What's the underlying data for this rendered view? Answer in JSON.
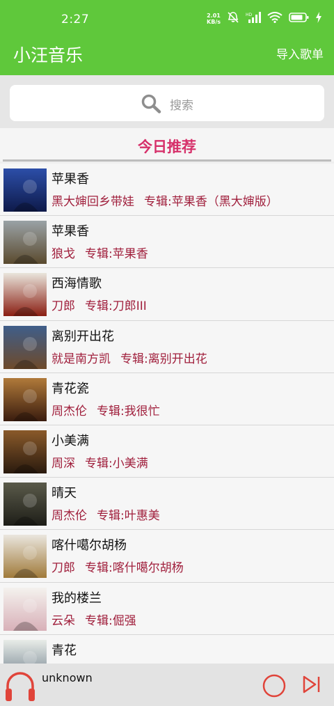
{
  "status_bar": {
    "time": "2:27",
    "net_speed_value": "2.01",
    "net_speed_unit": "KB/s"
  },
  "app_bar": {
    "title": "小汪音乐",
    "action_label": "导入歌单"
  },
  "search": {
    "placeholder": "搜索"
  },
  "section": {
    "title": "今日推荐"
  },
  "songs": [
    {
      "title": "苹果香",
      "artist": "黑大婶回乡带娃",
      "album": "专辑:苹果香（黑大婶版）",
      "cover_colors": [
        "#2c4ea8",
        "#0e1a4a"
      ]
    },
    {
      "title": "苹果香",
      "artist": "狼戈",
      "album": "专辑:苹果香",
      "cover_colors": [
        "#9aa2a6",
        "#5a4a2e"
      ]
    },
    {
      "title": "西海情歌",
      "artist": "刀郎",
      "album": "专辑:刀郎III",
      "cover_colors": [
        "#e9e5dc",
        "#8a1e12"
      ]
    },
    {
      "title": "离别开出花",
      "artist": "就是南方凯",
      "album": "专辑:离别开出花",
      "cover_colors": [
        "#3f5e8a",
        "#6e4a2a"
      ]
    },
    {
      "title": "青花瓷",
      "artist": "周杰伦",
      "album": "专辑:我很忙",
      "cover_colors": [
        "#b07a3a",
        "#3a1c0e"
      ]
    },
    {
      "title": "小美满",
      "artist": "周深",
      "album": "专辑:小美满",
      "cover_colors": [
        "#8a5a2a",
        "#2a1a0e"
      ]
    },
    {
      "title": "晴天",
      "artist": "周杰伦",
      "album": "专辑:叶惠美",
      "cover_colors": [
        "#5a5a4a",
        "#1e1e18"
      ]
    },
    {
      "title": "喀什噶尔胡杨",
      "artist": "刀郎",
      "album": "专辑:喀什噶尔胡杨",
      "cover_colors": [
        "#eae6de",
        "#a07a3a"
      ]
    },
    {
      "title": "我的楼兰",
      "artist": "云朵",
      "album": "专辑:倔强",
      "cover_colors": [
        "#f4f2ee",
        "#d8b0b8"
      ]
    },
    {
      "title": "青花",
      "artist": "",
      "album": "",
      "cover_colors": [
        "#e8ece8",
        "#6a7a88"
      ]
    }
  ],
  "player": {
    "track": "unknown"
  },
  "colors": {
    "accent_green": "#5fc83b",
    "section_title": "#d6306a",
    "meta_text": "#a01f3c",
    "player_icon": "#e0443a"
  },
  "icons": {
    "search": "search-icon",
    "headphones": "headphones-icon",
    "play": "play-circle-icon",
    "next": "skip-next-icon"
  }
}
